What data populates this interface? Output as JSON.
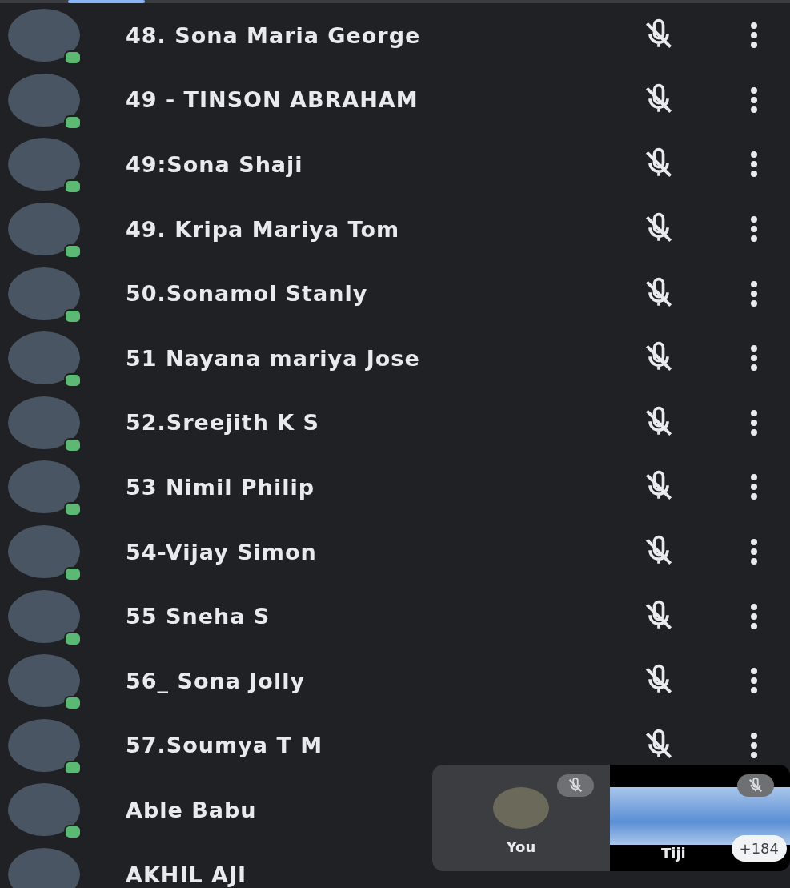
{
  "participants": [
    {
      "name": "48. Sona Maria George",
      "muted": true
    },
    {
      "name": "49 - TINSON ABRAHAM",
      "muted": true
    },
    {
      "name": "49:Sona Shaji",
      "muted": true
    },
    {
      "name": "49. Kripa Mariya Tom",
      "muted": true
    },
    {
      "name": "50.Sonamol Stanly",
      "muted": true
    },
    {
      "name": "51 Nayana mariya Jose",
      "muted": true
    },
    {
      "name": "52.Sreejith K S",
      "muted": true
    },
    {
      "name": "53 Nimil Philip",
      "muted": true
    },
    {
      "name": "54-Vijay Simon",
      "muted": true
    },
    {
      "name": "55 Sneha S",
      "muted": true
    },
    {
      "name": "56_ Sona Jolly",
      "muted": true
    },
    {
      "name": "57.Soumya T M",
      "muted": true
    },
    {
      "name": "Able Babu"
    },
    {
      "name": "AKHIL AJI"
    }
  ],
  "self_view": {
    "label": "You",
    "muted": true
  },
  "shared_tile": {
    "name": "Tiji",
    "muted": true,
    "others_count": "+184"
  }
}
